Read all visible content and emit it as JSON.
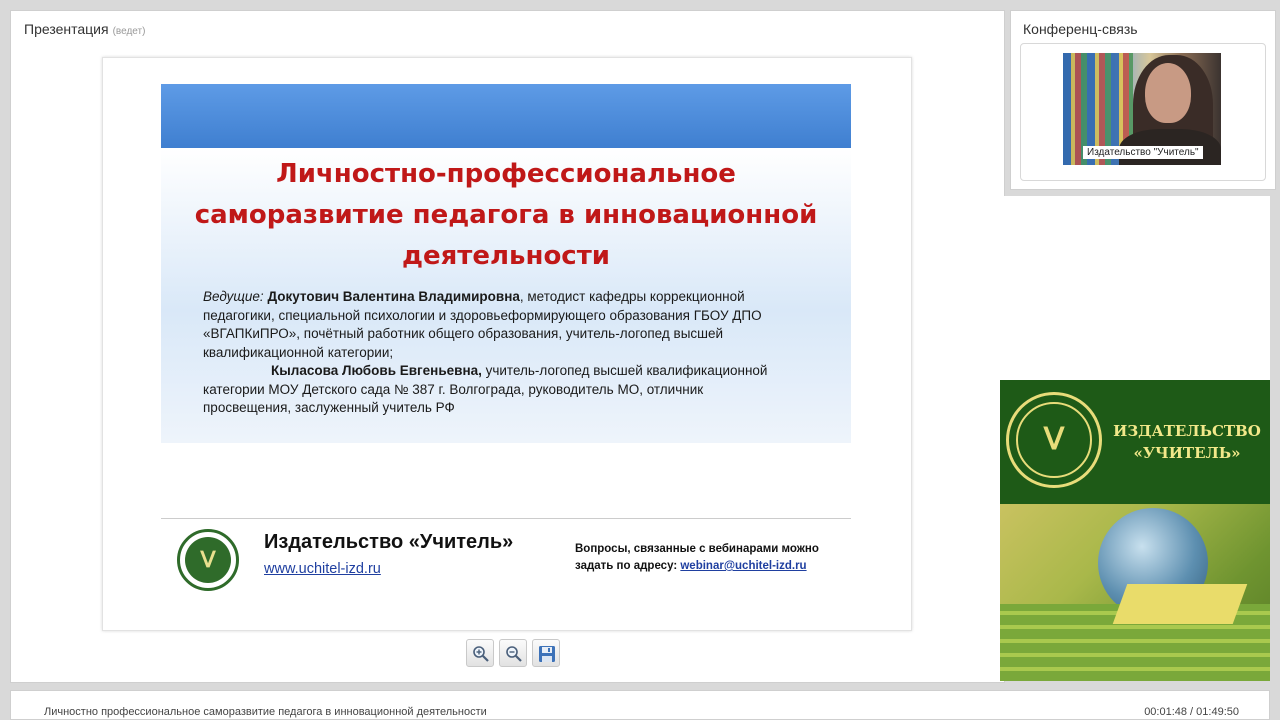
{
  "presentation": {
    "title": "Презентация",
    "status": "(ведет)"
  },
  "slide": {
    "title": "Личностно-профессиональное саморазвитие педагога в инновационной деятельности",
    "presenters_label": "Ведущие:",
    "presenter1_name": "Докутович Валентина Владимировна",
    "presenter1_desc": ", методист кафедры коррекционной педагогики, специальной психологии и здоровьеформирующего образования ГБОУ ДПО «ВГАПКиПРО», почётный работник общего образования, учитель-логопед высшей квалификационной категории;",
    "presenter2_name": "Кыласова Любовь Евгеньевна,",
    "presenter2_desc": " учитель-логопед высшей квалификационной категории МОУ Детского сада № 387 г. Волгограда, руководитель МО, отличник просвещения, заслуженный учитель РФ",
    "footer_publisher": "Издательство «Учитель»",
    "footer_site": "www.uchitel-izd.ru",
    "footer_question_line1": "Вопросы, связанные с вебинарами можно",
    "footer_question_line2": "задать по адресу:",
    "footer_email": "webinar@uchitel-izd.ru"
  },
  "toolbar": {
    "zoom_in_icon": "zoom-in-icon",
    "zoom_out_icon": "zoom-out-icon",
    "save_icon": "save-icon"
  },
  "conference": {
    "title": "Конференц-связь",
    "video_caption": "Издательство \"Учитель\""
  },
  "banner": {
    "line1": "ИЗДАТЕЛЬСТВО",
    "line2": "«УЧИТЕЛЬ»"
  },
  "bottom": {
    "webinar_title": "Личностно профессиональное саморазвитие педагога в инновационной деятельности",
    "time": "00:01:48 / 01:49:50"
  },
  "colors": {
    "slide_title": "#c01818",
    "link": "#1f3fa0",
    "banner_green": "#1e5a17",
    "banner_text": "#f2e88a"
  }
}
